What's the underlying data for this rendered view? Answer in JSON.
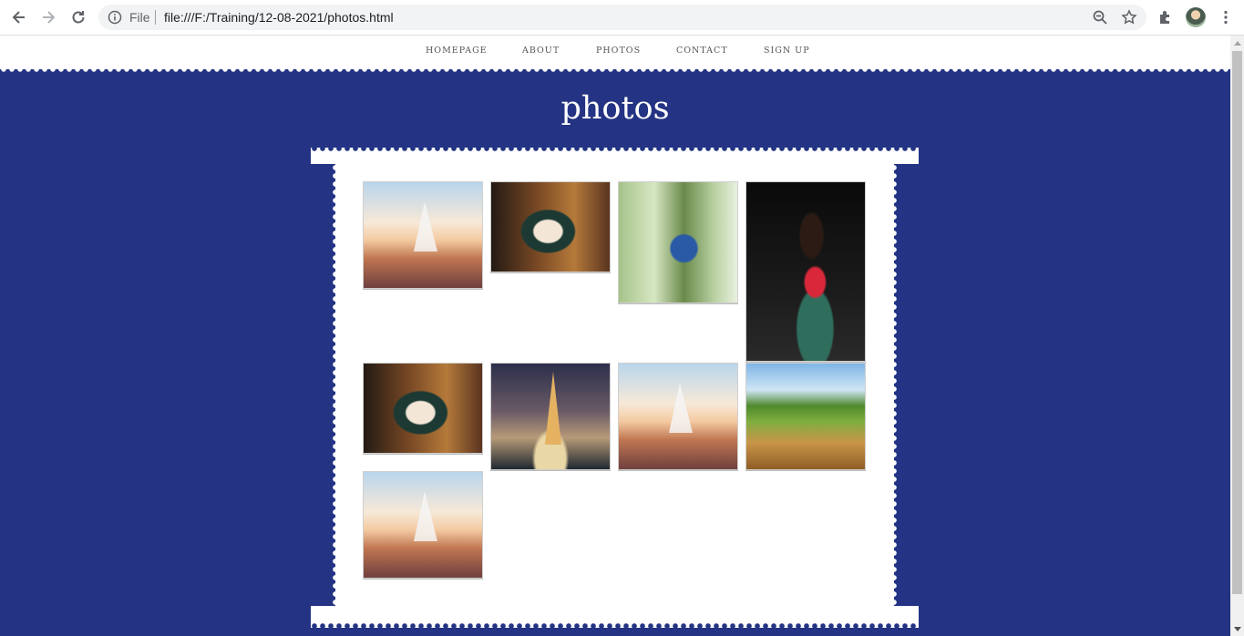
{
  "browser": {
    "file_label": "File",
    "url": "file:///F:/Training/12-08-2021/photos.html"
  },
  "nav": {
    "items": [
      "HOMEPAGE",
      "ABOUT",
      "PHOTOS",
      "CONTACT",
      "SIGN UP"
    ]
  },
  "page": {
    "title": "photos"
  },
  "colors": {
    "background": "#243383",
    "panel": "#ffffff"
  },
  "gallery": {
    "photos": [
      "sailing-ship",
      "krishna",
      "girl-in-tree",
      "girl-red-top",
      "krishna",
      "eiffel-tower",
      "sailing-ship",
      "nature-pond",
      "sailing-ship"
    ]
  }
}
